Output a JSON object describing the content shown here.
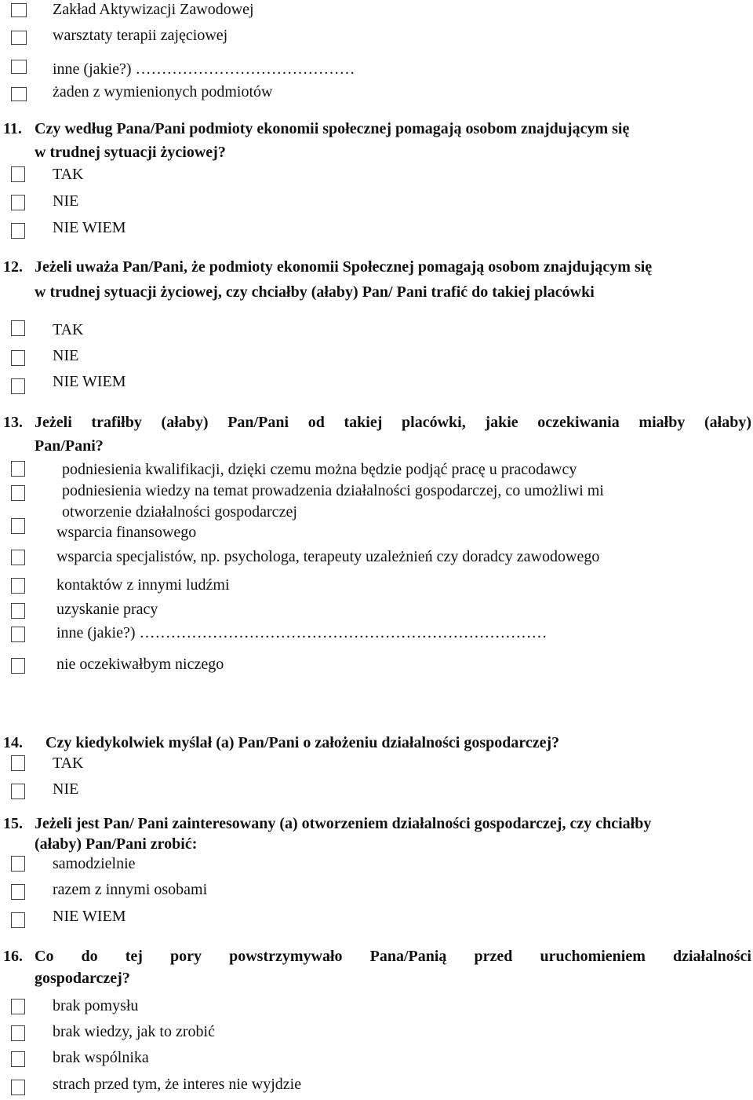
{
  "top_options": [
    "Zakład  Aktywizacji Zawodowej",
    "warsztaty terapii zajęciowej",
    "inne (jakie?) ……………………………………",
    "żaden z wymienionych podmiotów"
  ],
  "questions": [
    {
      "number": "11.",
      "lines": [
        "Czy według Pana/Pani podmioty ekonomii społecznej pomagają osobom znajdującym się",
        "w trudnej sytuacji życiowej?"
      ],
      "options": [
        "TAK",
        "NIE",
        "NIE WIEM"
      ]
    },
    {
      "number": "12.",
      "lines": [
        "Jeżeli uważa Pan/Pani, że podmioty ekonomii Społecznej pomagają osobom znajdującym się",
        "w trudnej sytuacji życiowej, czy chciałby (ałaby) Pan/ Pani trafić do takiej placówki"
      ],
      "options": [
        "TAK",
        "NIE",
        "NIE WIEM"
      ]
    },
    {
      "number": "13.",
      "lines": [
        "Jeżeli trafiłby (ałaby) Pan/Pani od takiej  placówki, jakie oczekiwania miałby (ałaby)",
        "Pan/Pani?"
      ],
      "options": [
        "podniesienia kwalifikacji, dzięki czemu można będzie podjąć pracę u pracodawcy",
        "podniesienia wiedzy na temat prowadzenia działalności gospodarczej, co umożliwi mi",
        "otworzenie działalności gospodarczej",
        "wsparcia finansowego",
        "wsparcia specjalistów, np. psychologa, terapeuty uzależnień czy doradcy zawodowego",
        "kontaktów z innymi ludźmi",
        "uzyskanie pracy",
        "inne (jakie?) ……………………………………………………………………",
        "nie oczekiwałbym niczego"
      ]
    },
    {
      "number": "14.",
      "lines": [
        "Czy kiedykolwiek myślał (a) Pan/Pani o założeniu działalności gospodarczej?"
      ],
      "options": [
        "TAK",
        "NIE"
      ]
    },
    {
      "number": "15.",
      "lines": [
        "Jeżeli jest Pan/ Pani zainteresowany (a) otworzeniem działalności gospodarczej, czy chciałby",
        "(ałaby)  Pan/Pani zrobić:"
      ],
      "options": [
        "samodzielnie",
        "razem z innymi osobami",
        "NIE WIEM"
      ]
    },
    {
      "number": "16.",
      "lines": [
        "Co do tej pory powstrzymywało Pana/Panią przed uruchomieniem działalności",
        "gospodarczej?"
      ],
      "options": [
        "brak pomysłu",
        "brak wiedzy, jak to zrobić",
        "brak wspólnika",
        "strach przed tym, że interes nie wyjdzie"
      ]
    }
  ]
}
